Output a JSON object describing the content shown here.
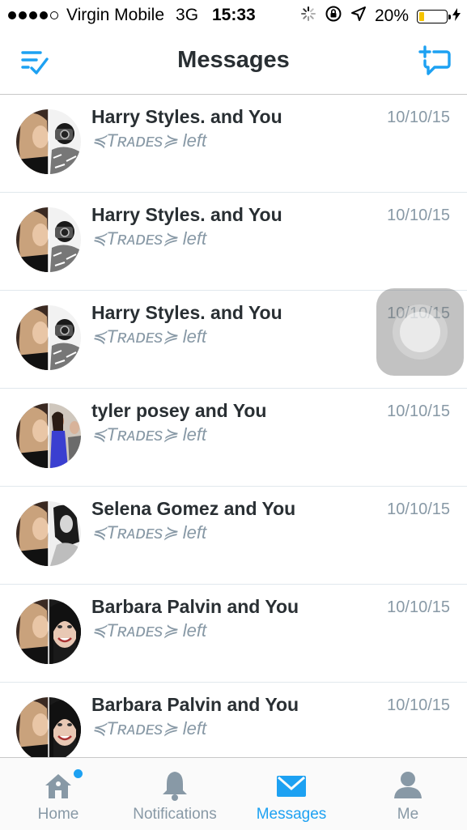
{
  "status_bar": {
    "carrier": "Virgin Mobile",
    "network": "3G",
    "time": "15:33",
    "battery": "20%",
    "battery_level": 0.2,
    "signal_bars": 4
  },
  "header": {
    "title": "Messages",
    "left_icon": "edit-list-icon",
    "right_icon": "new-message-icon"
  },
  "conversations": [
    {
      "title": "Harry Styles. and You",
      "subtitle": "≼Tʀᴀᴅᴇs≽ left",
      "date": "10/10/15",
      "avatar": "bw-man"
    },
    {
      "title": "Harry Styles. and You",
      "subtitle": "≼Tʀᴀᴅᴇs≽ left",
      "date": "10/10/15",
      "avatar": "bw-man"
    },
    {
      "title": "Harry Styles. and You",
      "subtitle": "≼Tʀᴀᴅᴇs≽ left",
      "date": "10/10/15",
      "avatar": "bw-man"
    },
    {
      "title": "tyler posey and You",
      "subtitle": "≼Tʀᴀᴅᴇs≽ left",
      "date": "10/10/15",
      "avatar": "blue-dress"
    },
    {
      "title": "Selena Gomez and You",
      "subtitle": "≼Tʀᴀᴅᴇs≽ left",
      "date": "10/10/15",
      "avatar": "bw-woman"
    },
    {
      "title": "Barbara Palvin and You",
      "subtitle": "≼Tʀᴀᴅᴇs≽ left",
      "date": "10/10/15",
      "avatar": "smile-woman"
    },
    {
      "title": "Barbara Palvin and You",
      "subtitle": "≼Tʀᴀᴅᴇs≽ left",
      "date": "10/10/15",
      "avatar": "smile-woman"
    }
  ],
  "tabs": [
    {
      "label": "Home",
      "icon": "home-icon",
      "active": false,
      "has_badge": true
    },
    {
      "label": "Notifications",
      "icon": "bell-icon",
      "active": false,
      "has_badge": false
    },
    {
      "label": "Messages",
      "icon": "envelope-icon",
      "active": true,
      "has_badge": false
    },
    {
      "label": "Me",
      "icon": "person-icon",
      "active": false,
      "has_badge": false
    }
  ],
  "colors": {
    "accent": "#1da1f2",
    "text_primary": "#292f33",
    "text_secondary": "#8899a6",
    "divider": "#e1e8ed"
  }
}
